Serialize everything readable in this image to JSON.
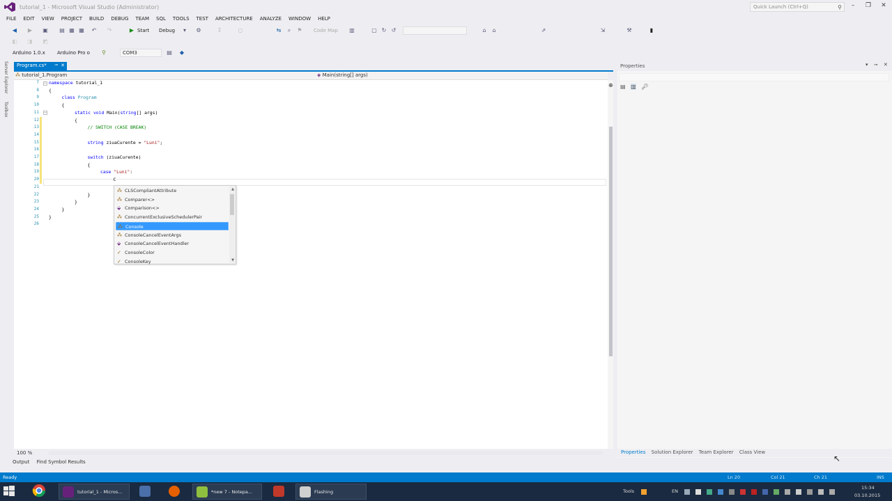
{
  "window": {
    "title": "tutorial_1 - Microsoft Visual Studio (Administrator)",
    "quick_launch_placeholder": "Quick Launch (Ctrl+Q)"
  },
  "menu": [
    "FILE",
    "EDIT",
    "VIEW",
    "PROJECT",
    "BUILD",
    "DEBUG",
    "TEAM",
    "SQL",
    "TOOLS",
    "TEST",
    "ARCHITECTURE",
    "ANALYZE",
    "WINDOW",
    "HELP"
  ],
  "toolbar": {
    "start_label": "Start",
    "config_label": "Debug",
    "code_map_label": "Code Map",
    "board_combo": "Arduino 1.0.x",
    "platform_combo": "Arduino Pro o",
    "port_combo": "COM3"
  },
  "side_tabs": [
    "Server Explorer",
    "Toolbox"
  ],
  "document": {
    "tab_label": "Program.cs*",
    "nav_left": "tutorial_1.Program",
    "nav_right": "Main(string[] args)"
  },
  "code": {
    "line_numbers": [
      "7",
      "8",
      "9",
      "10",
      "11",
      "12",
      "13",
      "14",
      "15",
      "16",
      "17",
      "18",
      "19",
      "20",
      "21",
      "22",
      "23",
      "24",
      "25",
      "26"
    ],
    "lines": [
      {
        "indent": 0,
        "parts": [
          [
            "kw",
            "namespace"
          ],
          [
            "plain",
            " tutorial_1"
          ]
        ]
      },
      {
        "indent": 0,
        "parts": [
          [
            "plain",
            "{"
          ]
        ]
      },
      {
        "indent": 1,
        "parts": [
          [
            "kw",
            "class"
          ],
          [
            "plain",
            " "
          ],
          [
            "cls",
            "Program"
          ]
        ]
      },
      {
        "indent": 1,
        "parts": [
          [
            "plain",
            "{"
          ]
        ]
      },
      {
        "indent": 2,
        "parts": [
          [
            "kw",
            "static"
          ],
          [
            "plain",
            " "
          ],
          [
            "kw",
            "void"
          ],
          [
            "plain",
            " Main("
          ],
          [
            "kw",
            "string"
          ],
          [
            "plain",
            "[] args)"
          ]
        ]
      },
      {
        "indent": 2,
        "parts": [
          [
            "plain",
            "{"
          ]
        ]
      },
      {
        "indent": 3,
        "parts": [
          [
            "cmt",
            "// SWITCH (CASE BREAK)"
          ]
        ]
      },
      {
        "indent": 3,
        "parts": []
      },
      {
        "indent": 3,
        "parts": [
          [
            "kw",
            "string"
          ],
          [
            "plain",
            " ziuaCurente = "
          ],
          [
            "str",
            "\"Luni\""
          ],
          [
            "plain",
            ";"
          ]
        ]
      },
      {
        "indent": 3,
        "parts": []
      },
      {
        "indent": 3,
        "parts": [
          [
            "kw",
            "switch"
          ],
          [
            "plain",
            " (ziuaCurente)"
          ]
        ]
      },
      {
        "indent": 3,
        "parts": [
          [
            "plain",
            "{"
          ]
        ]
      },
      {
        "indent": 4,
        "parts": [
          [
            "kw",
            "case"
          ],
          [
            "plain",
            " "
          ],
          [
            "str",
            "\"Luni\""
          ],
          [
            "plain",
            ":"
          ]
        ]
      },
      {
        "indent": 5,
        "parts": [
          [
            "plain",
            "C"
          ]
        ]
      },
      {
        "indent": 3,
        "parts": []
      },
      {
        "indent": 3,
        "parts": [
          [
            "plain",
            "}"
          ]
        ]
      },
      {
        "indent": 2,
        "parts": [
          [
            "plain",
            "}"
          ]
        ]
      },
      {
        "indent": 1,
        "parts": [
          [
            "plain",
            "}"
          ]
        ]
      },
      {
        "indent": 0,
        "parts": [
          [
            "plain",
            "}"
          ]
        ]
      },
      {
        "indent": 0,
        "parts": []
      }
    ]
  },
  "intellisense": {
    "items": [
      {
        "label": "CLSCompliantAttribute",
        "icon": "class-icon"
      },
      {
        "label": "Comparer<>",
        "icon": "class-icon"
      },
      {
        "label": "Comparison<>",
        "icon": "delegate-icon"
      },
      {
        "label": "ConcurrentExclusiveSchedulerPair",
        "icon": "class-icon"
      },
      {
        "label": "Console",
        "icon": "class-icon",
        "selected": true
      },
      {
        "label": "ConsoleCancelEventArgs",
        "icon": "class-icon"
      },
      {
        "label": "ConsoleCancelEventHandler",
        "icon": "delegate-icon"
      },
      {
        "label": "ConsoleColor",
        "icon": "enum-icon"
      },
      {
        "label": "ConsoleKey",
        "icon": "enum-icon"
      }
    ]
  },
  "editor_bottom": {
    "zoom": "100 %",
    "output_tabs": [
      "Output",
      "Find Symbol Results"
    ]
  },
  "properties": {
    "title": "Properties",
    "bottom_tabs": [
      "Properties",
      "Solution Explorer",
      "Team Explorer",
      "Class View"
    ]
  },
  "status": {
    "ready": "Ready",
    "ln": "Ln 20",
    "col": "Col 21",
    "ch": "Ch 21",
    "ins": "INS"
  },
  "taskbar": {
    "buttons": [
      {
        "label": "tutorial_1 - Micros...",
        "color": "#68217a"
      },
      {
        "label": "*new 7 - Notepa...",
        "color": "#8fbf3f"
      },
      {
        "label": "Flashing",
        "color": "#d0d0d0"
      }
    ],
    "tray_tools": "Tools",
    "tray_lang": "EN",
    "time": "15:34",
    "date": "03.10.2015"
  },
  "colors": {
    "accent": "#007acc",
    "selection": "#3399ff",
    "keyword": "#0000ff",
    "type": "#2b91af",
    "string": "#a31515",
    "comment": "#008000"
  }
}
